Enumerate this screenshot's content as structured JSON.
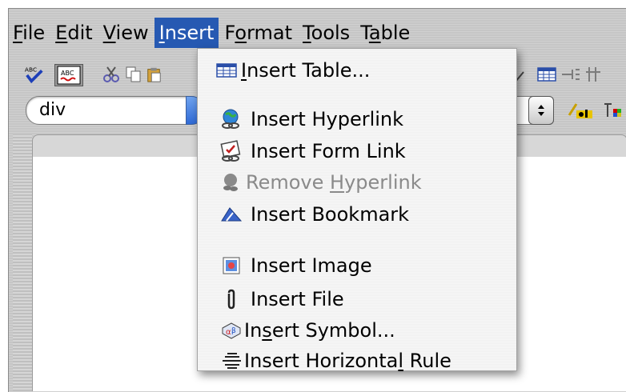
{
  "menubar": {
    "items": [
      {
        "label": "File",
        "pre": "",
        "ul": "F",
        "post": "ile"
      },
      {
        "label": "Edit",
        "pre": "",
        "ul": "E",
        "post": "dit"
      },
      {
        "label": "View",
        "pre": "",
        "ul": "V",
        "post": "iew"
      },
      {
        "label": "Insert",
        "pre": "",
        "ul": "I",
        "post": "nsert"
      },
      {
        "label": "Format",
        "pre": "F",
        "ul": "o",
        "post": "rmat"
      },
      {
        "label": "Tools",
        "pre": "",
        "ul": "T",
        "post": "ools"
      },
      {
        "label": "Table",
        "pre": "T",
        "ul": "a",
        "post": "ble"
      }
    ]
  },
  "toolbar": {
    "spell_check_label": "ABC",
    "live_spell_label": "ABC"
  },
  "paragraph_style": {
    "value": "div"
  },
  "insert_menu": {
    "items": [
      {
        "name": "insert-table",
        "pre": "",
        "ul": "I",
        "post": "nsert Table...",
        "icon": "table-icon",
        "enabled": true
      },
      {
        "name": "insert-hyperlink",
        "pre": "Insert ",
        "ul": "",
        "post": "Hyperlink",
        "icon": "globe-link-icon",
        "enabled": true
      },
      {
        "name": "insert-form-link",
        "pre": "Insert Form Link",
        "ul": "",
        "post": "",
        "icon": "form-link-icon",
        "enabled": true
      },
      {
        "name": "remove-hyperlink",
        "pre": "Remove ",
        "ul": "H",
        "post": "yperlink",
        "icon": "remove-link-icon",
        "enabled": false
      },
      {
        "name": "insert-bookmark",
        "pre": "Insert Bookmark",
        "ul": "",
        "post": "",
        "icon": "bookmark-icon",
        "enabled": true
      },
      {
        "name": "insert-image",
        "pre": "Insert Image",
        "ul": "",
        "post": "",
        "icon": "image-icon",
        "enabled": true
      },
      {
        "name": "insert-file",
        "pre": "Insert File",
        "ul": "",
        "post": "",
        "icon": "paperclip-icon",
        "enabled": true
      },
      {
        "name": "insert-symbol",
        "pre": "In",
        "ul": "s",
        "post": "ert Symbol...",
        "icon": "symbol-icon",
        "enabled": true
      },
      {
        "name": "insert-horizontal-rule",
        "pre": "Insert Horizonta",
        "ul": "l",
        "post": " Rule",
        "icon": "horizontal-rule-icon",
        "enabled": true
      }
    ]
  }
}
